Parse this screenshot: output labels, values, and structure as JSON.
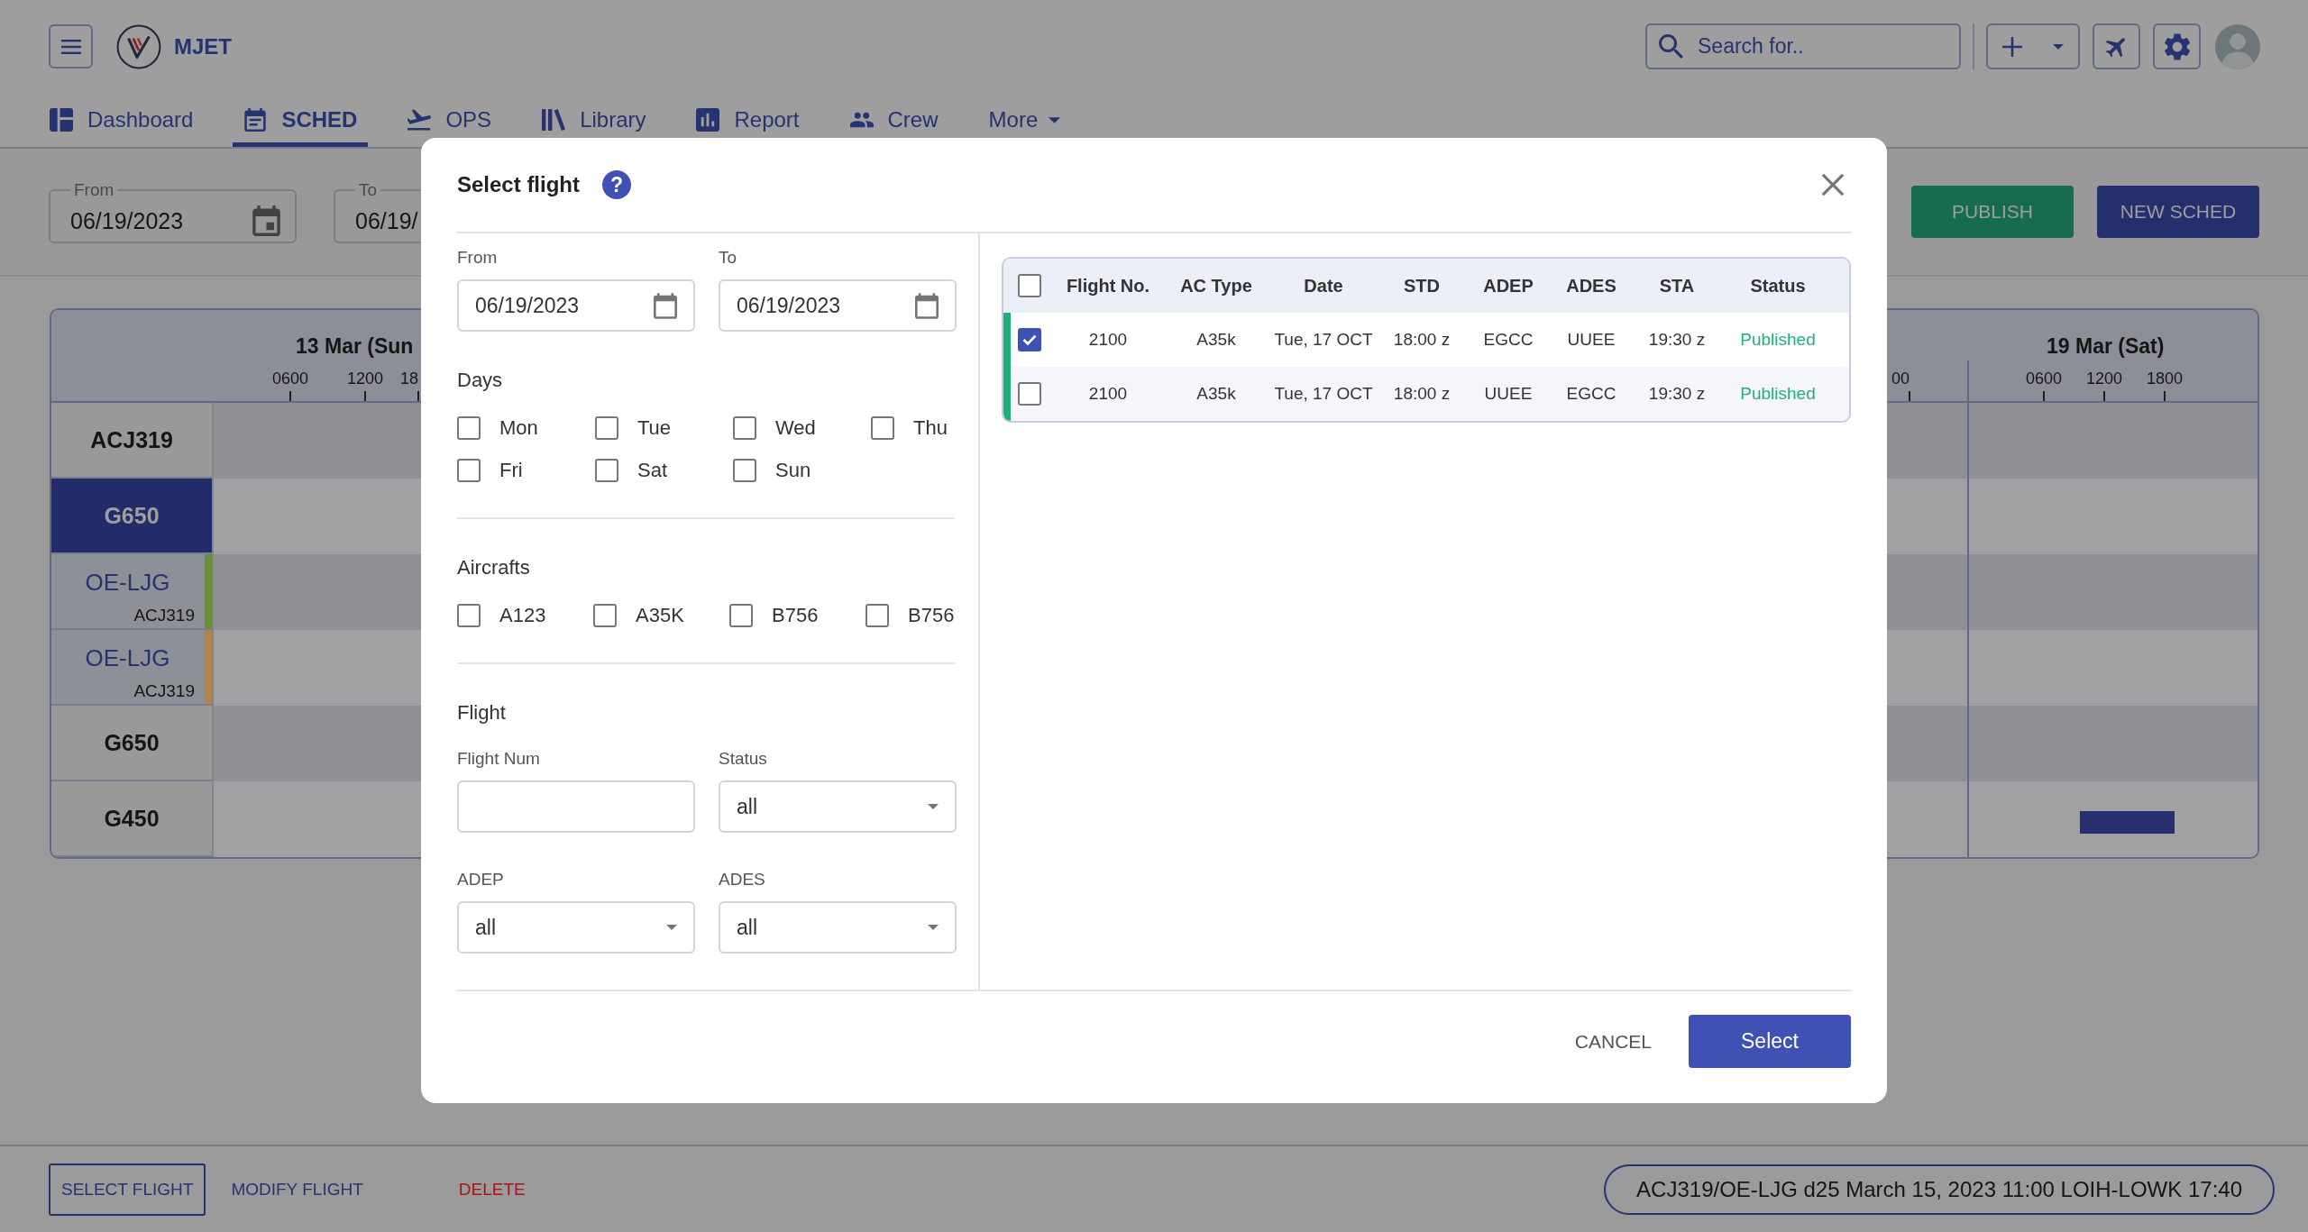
{
  "header": {
    "brand": "MJET",
    "search": {
      "placeholder": "Search for.."
    }
  },
  "tabs": [
    {
      "label": "Dashboard",
      "kind": "tab",
      "selected": false
    },
    {
      "label": "SCHED",
      "kind": "tab",
      "selected": true
    },
    {
      "label": "OPS",
      "kind": "tab",
      "selected": false
    },
    {
      "label": "Library",
      "kind": "tab",
      "selected": false
    },
    {
      "label": "Report",
      "kind": "tab",
      "selected": false
    },
    {
      "label": "Crew",
      "kind": "tab",
      "selected": false
    },
    {
      "label": "More",
      "kind": "menu",
      "selected": false
    }
  ],
  "toolbar": {
    "from": {
      "label": "From",
      "value": "06/19/2023"
    },
    "to": {
      "label": "To",
      "value": "06/19/"
    },
    "buttons": [
      {
        "label": "PUBLISH",
        "kind": "success"
      },
      {
        "label": "NEW SCHED",
        "kind": "primary"
      }
    ]
  },
  "schedule": {
    "days": [
      {
        "label": "13 Mar (Sun",
        "ticks": [
          "0600",
          "1200",
          "18"
        ]
      },
      {
        "ticks": [
          "00"
        ]
      },
      {
        "label": "19 Mar (Sat)",
        "ticks": [
          "0600",
          "1200",
          "1800"
        ]
      }
    ],
    "rows": [
      {
        "name": "ACJ319",
        "kind": "type",
        "selected": false,
        "flight_block": false
      },
      {
        "name": "G650",
        "kind": "type",
        "selected": true,
        "flight_block": false
      },
      {
        "name": "OE-LJG",
        "subtitle": "ACJ319",
        "kind": "aircraft",
        "color": "#6b8e34",
        "selected": false,
        "flight_block": false
      },
      {
        "name": "OE-LJG",
        "subtitle": "ACJ319",
        "kind": "aircraft",
        "color": "#b0834f",
        "selected": false,
        "flight_block": false
      },
      {
        "name": "G650",
        "kind": "type",
        "selected": false,
        "flight_block": false
      },
      {
        "name": "G450",
        "kind": "type",
        "selected": false,
        "flight_block": true
      }
    ]
  },
  "dialog": {
    "title": "Select flight",
    "help": "?",
    "dates": [
      {
        "label": "From",
        "value": "06/19/2023"
      },
      {
        "label": "To",
        "value": "06/19/2023"
      }
    ],
    "days": {
      "label": "Days",
      "options": [
        {
          "label": "Mon",
          "checked": false
        },
        {
          "label": "Tue",
          "checked": false
        },
        {
          "label": "Wed",
          "checked": false
        },
        {
          "label": "Thu",
          "checked": false
        },
        {
          "label": "Fri",
          "checked": false
        },
        {
          "label": "Sat",
          "checked": false
        },
        {
          "label": "Sun",
          "checked": false
        }
      ]
    },
    "aircrafts": {
      "label": "Aircrafts",
      "options": [
        {
          "label": "A123",
          "checked": false
        },
        {
          "label": "A35K",
          "checked": false
        },
        {
          "label": "B756",
          "checked": false
        },
        {
          "label": "B756",
          "checked": false
        }
      ]
    },
    "flight": {
      "label": "Flight",
      "fields": [
        {
          "label": "Flight Num",
          "kind": "input"
        },
        {
          "label": "Status",
          "kind": "select",
          "value": "all"
        },
        {
          "label": "ADEP",
          "kind": "select",
          "value": "all"
        },
        {
          "label": "ADES",
          "kind": "select",
          "value": "all"
        }
      ]
    },
    "table": {
      "select_all": false,
      "columns": [
        "Flight No.",
        "AC Type",
        "Date",
        "STD",
        "ADEP",
        "ADES",
        "STA",
        "Status"
      ],
      "rows": [
        {
          "selected": true,
          "flight_no": "2100",
          "ac_type": "A35k",
          "date": "Tue, 17 OCT",
          "std": "18:00 z",
          "adep": "EGCC",
          "ades": "UUEE",
          "sta": "19:30 z",
          "status": "Published"
        },
        {
          "selected": false,
          "flight_no": "2100",
          "ac_type": "A35k",
          "date": "Tue, 17 OCT",
          "std": "18:00 z",
          "adep": "UUEE",
          "ades": "EGCC",
          "sta": "19:30 z",
          "status": "Published"
        }
      ]
    },
    "buttons": [
      {
        "label": "CANCEL",
        "kind": "text"
      },
      {
        "label": "Select",
        "kind": "primary"
      }
    ]
  },
  "bottom_bar": {
    "actions": [
      {
        "label": "SELECT FLIGHT",
        "kind": "outlined"
      },
      {
        "label": "MODIFY FLIGHT",
        "kind": "text"
      },
      {
        "label": "DELETE",
        "kind": "danger"
      }
    ],
    "info": "ACJ319/OE-LJG d25 March 15, 2023 11:00 LOIH-LOWK 17:40"
  }
}
